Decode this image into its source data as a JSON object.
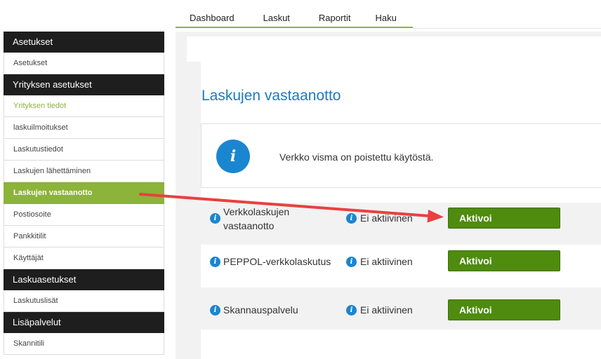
{
  "topnav": {
    "tabs": [
      {
        "label": "Dashboard"
      },
      {
        "label": "Laskut"
      },
      {
        "label": "Raportit"
      },
      {
        "label": "Haku"
      }
    ]
  },
  "sidebar": {
    "sections": [
      {
        "header": "Asetukset",
        "items": [
          {
            "label": "Asetukset"
          }
        ]
      },
      {
        "header": "Yrityksen asetukset",
        "items": [
          {
            "label": "Yrityksen tiedot"
          },
          {
            "label": "laskuilmoitukset"
          },
          {
            "label": "Laskutustiedot"
          },
          {
            "label": "Laskujen lähettäminen"
          },
          {
            "label": "Laskujen vastaanotto"
          },
          {
            "label": "Postiosoite"
          },
          {
            "label": "Pankkitilit"
          },
          {
            "label": "Käyttäjät"
          }
        ]
      },
      {
        "header": "Laskuasetukset",
        "items": [
          {
            "label": "Laskutuslisät"
          }
        ]
      },
      {
        "header": "Lisäpalvelut",
        "items": [
          {
            "label": "Skannitili"
          }
        ]
      }
    ],
    "active_item": "Laskujen vastaanotto",
    "accent_color": "#8cb33a"
  },
  "main": {
    "title": "Laskujen vastaanotto",
    "info": {
      "icon": "info-icon",
      "text": "Verkko visma on poistettu käytöstä."
    },
    "services": [
      {
        "name_line1": "Verkkolaskujen",
        "name_line2": "vastaanotto",
        "status": "Ei aktiivinen",
        "button": "Aktivoi"
      },
      {
        "name": "PEPPOL-verkkolaskutus",
        "status": "Ei aktiivinen",
        "button": "Aktivoi"
      },
      {
        "name": "Skannauspalvelu",
        "status": "Ei aktiivinen",
        "button": "Aktivoi"
      }
    ],
    "title_color": "#1a7bbf",
    "button_color": "#4e8b0e",
    "info_icon_color": "#1a86d0"
  },
  "annotation": {
    "type": "arrow",
    "color": "#e8413f",
    "icon": "red-arrow"
  }
}
